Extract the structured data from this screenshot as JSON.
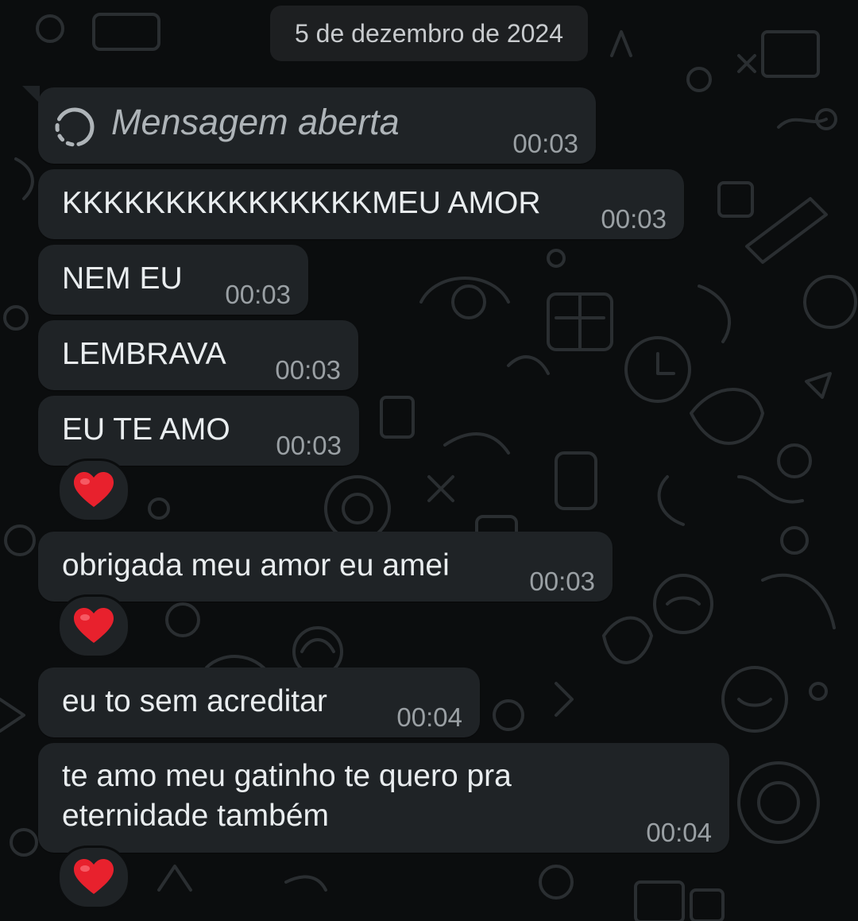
{
  "conversation": {
    "date_label": "5 de dezembro de 2024",
    "messages": [
      {
        "kind": "view-once-opened",
        "text": "Mensagem aberta",
        "time": "00:03"
      },
      {
        "kind": "text",
        "text": "KKKKKKKKKKKKKKKMEU AMOR",
        "time": "00:03"
      },
      {
        "kind": "text",
        "text": "NEM EU",
        "time": "00:03"
      },
      {
        "kind": "text",
        "text": "LEMBRAVA",
        "time": "00:03"
      },
      {
        "kind": "text",
        "text": "EU TE AMO",
        "time": "00:03",
        "reaction": "red-heart"
      },
      {
        "kind": "text",
        "text": "obrigada meu amor eu amei",
        "time": "00:03",
        "reaction": "red-heart"
      },
      {
        "kind": "text",
        "text": "eu to sem acreditar",
        "time": "00:04"
      },
      {
        "kind": "text",
        "text_lines": [
          "te amo meu gatinho te quero pra",
          "eternidade também"
        ],
        "time": "00:04",
        "reaction": "red-heart"
      }
    ]
  },
  "colors": {
    "background": "#0b0d0e",
    "bubble_incoming": "#1f2326",
    "message_text": "#e9edef",
    "timestamp": "#9aa0a4",
    "reaction_heart": "#e8212d"
  },
  "icons": {
    "opened": "dashed-circle-icon",
    "reaction": "red-heart-icon"
  }
}
